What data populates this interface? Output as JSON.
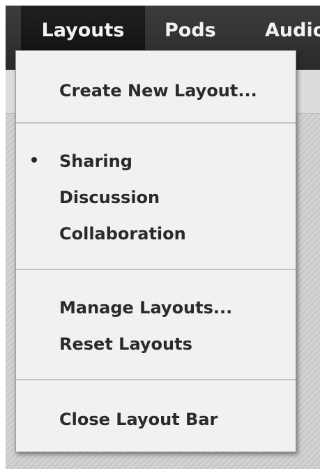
{
  "menubar": {
    "menus": [
      {
        "label": "Layouts"
      },
      {
        "label": "Pods"
      },
      {
        "label": "Audio"
      }
    ]
  },
  "dropdown": {
    "sections": [
      {
        "items": [
          {
            "label": "Create New Layout..."
          }
        ]
      },
      {
        "items": [
          {
            "label": "Sharing",
            "selected": true
          },
          {
            "label": "Discussion"
          },
          {
            "label": "Collaboration"
          }
        ]
      },
      {
        "items": [
          {
            "label": "Manage Layouts..."
          },
          {
            "label": "Reset Layouts"
          }
        ]
      },
      {
        "items": [
          {
            "label": "Close Layout Bar"
          }
        ]
      }
    ]
  },
  "colors": {
    "menubar_bg": "#2f2f2f",
    "active_menu_bg": "#151515",
    "menu_text": "#f2f2f2",
    "dropdown_bg": "#f1f1f1",
    "dropdown_text": "#2a2a2a",
    "separator": "#c4c4c4"
  }
}
